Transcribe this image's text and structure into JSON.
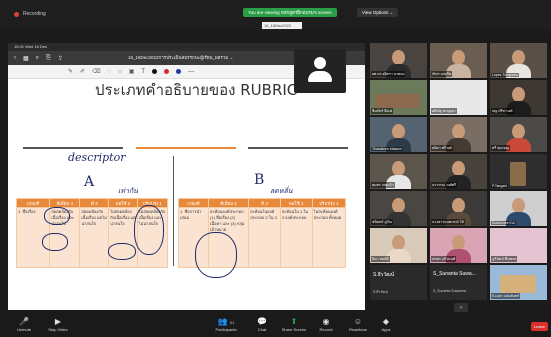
{
  "top": {
    "recording": "Recording",
    "share_banner": "You are viewing หลักสูตรฝึกอบรม's screen",
    "view_options": "View Options ⌄"
  },
  "shared_window": {
    "appbar_text": "15:31  Wed 16 Dec",
    "doc_title": "16_16Dec2022การประเมินสมรรถนะผู้เรียน_ผลรวม ⌄",
    "tab_label": "16_16Dec2022",
    "slide_title": "ประเภทคำอธิบายของ RUBRIC",
    "annot_descriptor": "descriptor",
    "annot_A": "A",
    "annot_B": "B",
    "annot_a_small": "a",
    "annot_left_note": "เท่ากัน",
    "annot_right_note": "ลดหลั่น",
    "left_table": {
      "headers": [
        "เกณฑ์",
        "ดีเยี่ยม 4",
        "ดี 3",
        "พอใช้ 2",
        "ปรับปรุง 1"
      ],
      "cells": [
        "1. ชื่อเรื่อง",
        "สอดคล้องกับเนื้อเรื่อง และน่าสนใจ",
        "สอดคล้องกับเนื้อเรื่อง แต่ไม่น่าสนใจ",
        "ไม่สอดคล้องกับเนื้อเรื่อง แต่น่าสนใจ",
        "ไม่สอดคล้องกับเนื้อเรื่อง และไม่น่าสนใจ"
      ]
    },
    "right_table": {
      "headers": [
        "เกณฑ์",
        "ดีเยี่ยม 4",
        "ดี 3",
        "พอใช้ 2",
        "ปรับปรุง 1"
      ],
      "cells": [
        "1. ชื่อการนำเสนอ",
        "สะท้อนองค์ประกอบ (1) ชื่อเรื่อง (2) เนื้อหา และ (3) กลุ่มเป้าหมาย",
        "สะท้อนในองค์ประกอบ 2 ใน 3",
        "สะท้อนใน 1 ใน 3 องค์ประกอบ",
        "ไม่สะท้อนองค์ประกอบ ทั้งหมด"
      ]
    }
  },
  "gallery": [
    {
      "label": "ผศ.ดร.สุจิตรา นาคคง"
    },
    {
      "label": "ภัทรา ผลเกิด"
    },
    {
      "label": "Lopez Tongkaew"
    },
    {
      "label": "ชินภัทร์ ลือเฟ"
    },
    {
      "label": "ศศิณัฐ สะบุญมา"
    },
    {
      "label": "ณฐ ปรีชาวงศ์"
    },
    {
      "label": "Thanakorn Intasorn"
    },
    {
      "label": "ธนิดา ศรีวงศ์"
    },
    {
      "label": "ศรี ชุมรอญ"
    },
    {
      "label": "สุนทร เกตุแก้ว"
    },
    {
      "label": "อรวรรณ วงศ์ศรี"
    },
    {
      "label": "P.Tangsiri"
    },
    {
      "label": "ชนินทร์ ภู่เงิน"
    },
    {
      "label": "นางสาวนนทภรณ์ โค้"
    },
    {
      "label": "Suwannee Kul"
    },
    {
      "label": "นิดา สมบัติ"
    },
    {
      "label": "ธนพร แก้วนนท์"
    },
    {
      "label": "ภูริวัฒน์ พึ่งเพชร"
    },
    {
      "label": "ผู้ใช้ 1"
    },
    {
      "label": "บุญพร ลิ้มเจริญ"
    },
    {
      "label": "Dr.Patcha"
    }
  ],
  "name_tiles": [
    {
      "name": "S.ธีรวัฒน์",
      "sub": "S.ธีรวัฒน์"
    },
    {
      "name": "S_Sunanta Suwa...",
      "sub": "S_Sunanta Suwanna"
    },
    {
      "name": "",
      "sub": "S.เมธา แจ่มจันทร์"
    }
  ],
  "controls": {
    "unmute": "Unmute",
    "start_video": "Stop Video",
    "participants": "Participants",
    "participants_count": "21",
    "chat": "Chat",
    "share": "Share Screen",
    "record": "Record",
    "reactions": "Reactions",
    "apps": "Apps",
    "leave": "Leave"
  },
  "colors": {
    "header_orange": "#e8893a",
    "cell_peach": "#fbe3d2",
    "share_green": "#2a9d47",
    "leave_red": "#d9302b"
  }
}
